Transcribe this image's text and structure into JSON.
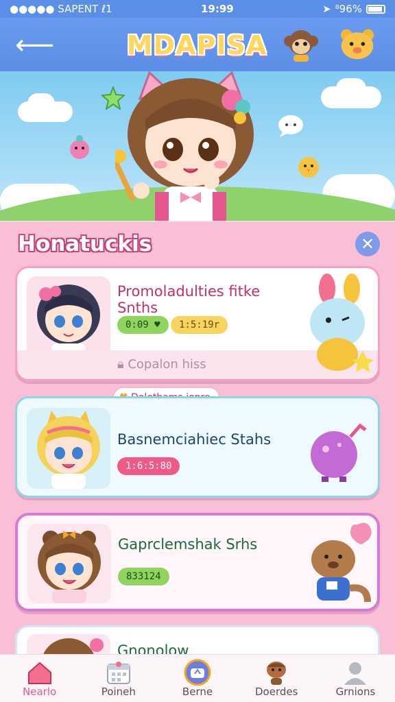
{
  "status": {
    "carrier": "●●●●● SAPENT ℓ1",
    "time": "19:99",
    "battery": "⁸96%"
  },
  "appbar": {
    "back_icon": "arrow-left-icon",
    "logo": "MDAPISA",
    "colors": {
      "bar": "#5b8ee6",
      "logo": "#ffd75e"
    }
  },
  "panel": {
    "title": "Honatuckis",
    "close_icon": "close-icon"
  },
  "cards": [
    {
      "title": "Promoladulties fitke Snths",
      "badges": [
        "0:09 ♥",
        "1:5:19r"
      ],
      "subtitle": "Copalon hiss"
    },
    {
      "title": "Basnemciahiec Stahs",
      "badges": [
        "1:6:5:80"
      ],
      "bubble": "Dolethams ionre"
    },
    {
      "title": "Gaprclemshak Srhs",
      "badges": [
        "833124"
      ]
    },
    {
      "title": "Gnonolow"
    }
  ],
  "tabs": [
    {
      "label": "Nearlo",
      "icon": "home-icon",
      "active": true
    },
    {
      "label": "Poineh",
      "icon": "calendar-icon",
      "active": false
    },
    {
      "label": "Berne",
      "icon": "game-icon",
      "active": false
    },
    {
      "label": "Doerdes",
      "icon": "character-icon",
      "active": false
    },
    {
      "label": "Grnions",
      "icon": "profile-icon",
      "active": false
    }
  ]
}
